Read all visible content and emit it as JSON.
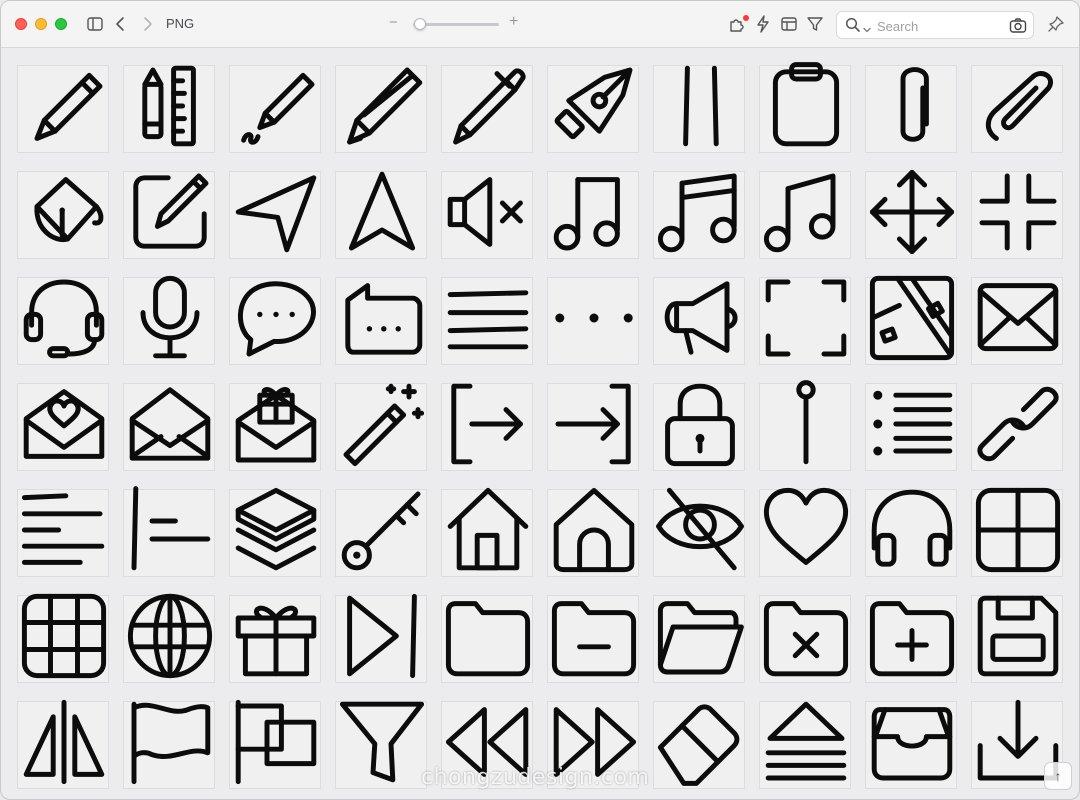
{
  "window": {
    "title": "PNG",
    "zoom": {
      "value": 0.04,
      "minus_symbol": "−",
      "plus_symbol": "+"
    }
  },
  "toolbar": {
    "icons": [
      "sidebar-toggle-icon",
      "back-icon",
      "forward-icon",
      "extension-icon",
      "lightning-icon",
      "layout-icon",
      "filter-icon",
      "pin-icon"
    ],
    "notification_color": "#ff3b30"
  },
  "search": {
    "placeholder": "Search",
    "value": ""
  },
  "watermark": "chongzudesign.com",
  "scroll_top_symbol": "↑",
  "grid": {
    "rows": [
      [
        "pencil",
        "pencil-ruler",
        "pencil-squiggle",
        "pencil-2",
        "pen",
        "fountain-pen-nib",
        "double-bar",
        "clipboard",
        "paperclip",
        "paperclip-2"
      ],
      [
        "paint-bucket",
        "edit-square",
        "navigation-arrow",
        "navigation-north",
        "speaker-mute",
        "music-note",
        "music-notes-double",
        "music-notes",
        "move-arrows",
        "minimize"
      ],
      [
        "headset",
        "microphone",
        "speech-bubble-dots",
        "message-dots",
        "menu-lines",
        "dots-horizontal",
        "megaphone",
        "fullscreen-corners",
        "map",
        "envelope"
      ],
      [
        "envelope-heart",
        "envelope-open",
        "envelope-gift",
        "magic-wand",
        "sign-out",
        "sign-in",
        "lock",
        "pin",
        "list-bullets",
        "link"
      ],
      [
        "text-align-left",
        "indent",
        "layers",
        "key",
        "home",
        "home-2",
        "eye-slash",
        "heart",
        "headphones",
        "grid-4"
      ],
      [
        "grid-9",
        "globe",
        "gift",
        "play-next",
        "folder",
        "folder-minus",
        "folder-open",
        "folder-x",
        "folder-plus",
        "floppy-disk"
      ],
      [
        "flip-horizontal",
        "flag",
        "flags",
        "funnel",
        "rewind",
        "fast-forward",
        "eraser",
        "eject",
        "inbox",
        "download"
      ]
    ]
  },
  "colors": {
    "ink": "#0c0c0c",
    "tile_bg": "#f0f0f1",
    "window_bg": "#ececee"
  }
}
